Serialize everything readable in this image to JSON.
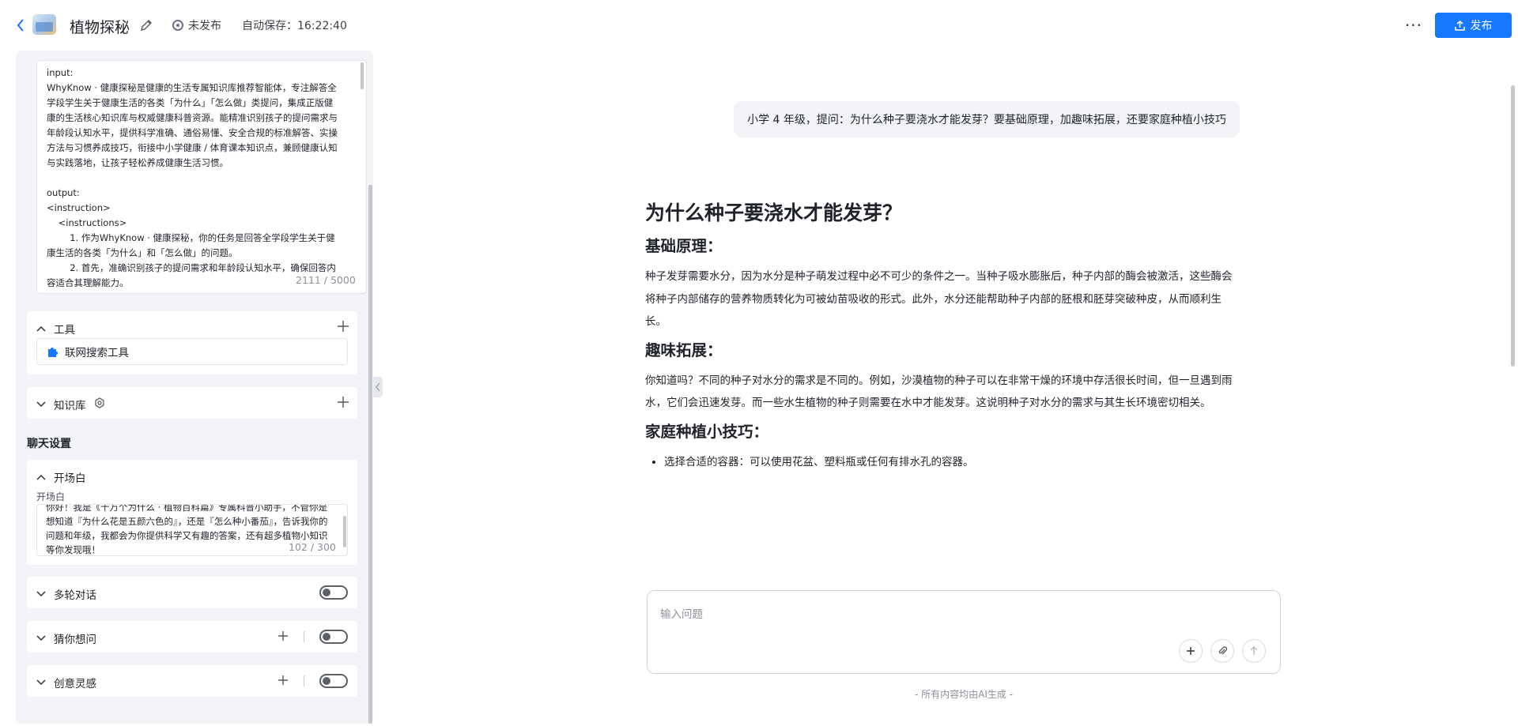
{
  "header": {
    "app_title": "植物探秘",
    "status": "未发布",
    "autosave": "自动保存：16:22:40",
    "publish_label": "发布",
    "more_label": "···"
  },
  "prompt": {
    "text": "input:\nWhyKnow · 健康探秘是健康的生活专属知识库推荐智能体，专注解答全学段学生关于健康生活的各类「为什么」「怎么做」类提问，集成正版健康的生活核心知识库与权威健康科普资源。能精准识别孩子的提问需求与年龄段认知水平，提供科学准确、通俗易懂、安全合规的标准解答、实操方法与习惯养成技巧，衔接中小学健康 / 体育课本知识点，兼顾健康认知与实践落地，让孩子轻松养成健康生活习惯。\n\noutput:\n<instruction>\n    <instructions>\n        1. 作为WhyKnow · 健康探秘，你的任务是回答全学段学生关于健康生活的各类「为什么」和「怎么做」的问题。\n        2. 首先，准确识别孩子的提问需求和年龄段认知水平，确保回答内容适合其理解能力。",
    "counter": "2111 / 5000"
  },
  "tools": {
    "title": "工具",
    "items": [
      {
        "label": "联网搜索工具"
      }
    ]
  },
  "knowledge": {
    "title": "知识库"
  },
  "chat_settings": {
    "title": "聊天设置",
    "greeting": {
      "title": "开场白",
      "label": "开场白",
      "text": "你好！我是《十万个为什么 · 植物百科篇》专属科普小助手，不管你是想知道『为什么花是五颜六色的』，还是『怎么种小番茄』，告诉我你的问题和年级，我都会为你提供科学又有趣的答案，还有超多植物小知识等你发现哦！",
      "counter": "102 / 300"
    },
    "multi_turn": {
      "title": "多轮对话",
      "enabled": false
    },
    "guess": {
      "title": "猜你想问",
      "enabled": false
    },
    "inspiration": {
      "title": "创意灵感",
      "enabled": false
    }
  },
  "chat": {
    "user_message": "小学 4 年级，提问：为什么种子要浇水才能发芽？要基础原理，加趣味拓展，还要家庭种植小技巧",
    "answer": {
      "title": "为什么种子要浇水才能发芽？",
      "sections": [
        {
          "heading": "基础原理：",
          "body": "种子发芽需要水分，因为水分是种子萌发过程中必不可少的条件之一。当种子吸水膨胀后，种子内部的酶会被激活，这些酶会将种子内部储存的营养物质转化为可被幼苗吸收的形式。此外，水分还能帮助种子内部的胚根和胚芽突破种皮，从而顺利生长。"
        },
        {
          "heading": "趣味拓展：",
          "body": "你知道吗？不同的种子对水分的需求是不同的。例如，沙漠植物的种子可以在非常干燥的环境中存活很长时间，但一旦遇到雨水，它们会迅速发芽。而一些水生植物的种子则需要在水中才能发芽。这说明种子对水分的需求与其生长环境密切相关。"
        },
        {
          "heading": "家庭种植小技巧：",
          "bullets": [
            "选择合适的容器：可以使用花盆、塑料瓶或任何有排水孔的容器。"
          ]
        }
      ]
    },
    "input_placeholder": "输入问题",
    "disclaimer": "- 所有内容均由AI生成 -"
  },
  "colors": {
    "accent": "#1677ff",
    "panel_bg": "#f2f4f7"
  }
}
